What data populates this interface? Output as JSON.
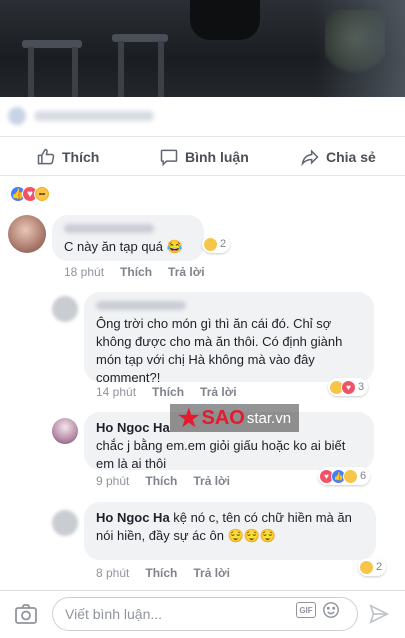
{
  "actions": {
    "like": "Thích",
    "comment": "Bình luận",
    "share": "Chia sẻ"
  },
  "comments": [
    {
      "text": "C này ăn tạp quá 😂",
      "time": "18 phút",
      "like": "Thích",
      "reply": "Trả lời",
      "reaction_count": "2"
    },
    {
      "text": "Ông trời cho món gì thì ăn cái đó. Chỉ sợ không được cho mà ăn thôi. Có định giành món tạp với chị Hà không mà vào đây comment?!",
      "time": "14 phút",
      "like": "Thích",
      "reply": "Trả lời",
      "reaction_count": "3"
    },
    {
      "name": "Ho Ngoc Ha",
      "text": "chắc j bằng em.em giỏi giấu hoặc ko ai biết em là ai thôi",
      "time": "9 phút",
      "like": "Thích",
      "reply": "Trả lời",
      "reaction_count": "6"
    },
    {
      "name": "Ho Ngoc Ha",
      "text": "kệ nó c, tên có chữ hiền mà ăn nói hiền, đầy sự ác ôn 😌😌😌",
      "time": "8 phút",
      "like": "Thích",
      "reply": "Trả lời",
      "reaction_count": "2"
    }
  ],
  "watermark": {
    "brand": "SAO",
    "suffix": "star.vn"
  },
  "composer": {
    "placeholder": "Viết bình luận...",
    "gif": "GIF"
  }
}
